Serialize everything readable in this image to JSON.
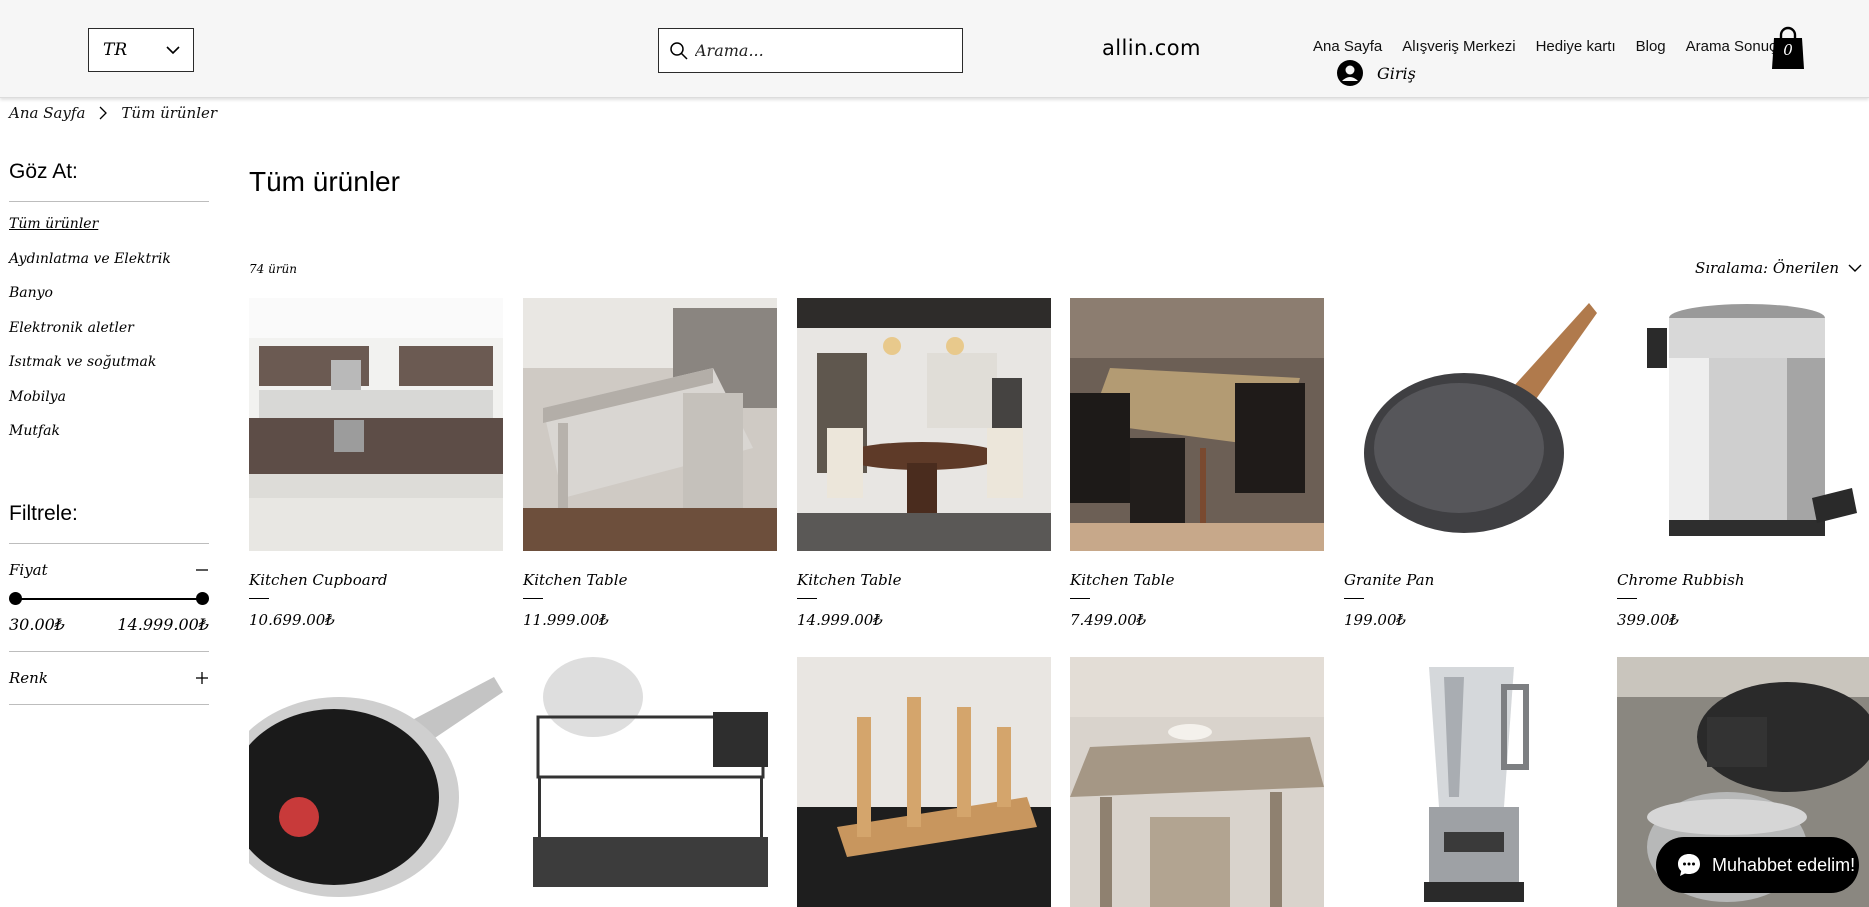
{
  "header": {
    "language": "TR",
    "search_placeholder": "Arama...",
    "logo": "allin.com",
    "nav": [
      "Ana Sayfa",
      "Alışveriş Merkezi",
      "Hediye kartı",
      "Blog",
      "Arama Sonuçları"
    ],
    "login_label": "Giriş",
    "cart_count": "0"
  },
  "breadcrumb": {
    "home": "Ana Sayfa",
    "current": "Tüm ürünler"
  },
  "sidebar": {
    "browse_title": "Göz At:",
    "categories": [
      "Tüm ürünler",
      "Aydınlatma ve Elektrik",
      "Banyo",
      "Elektronik aletler",
      "Isıtmak ve soğutmak",
      "Mobilya",
      "Mutfak"
    ],
    "filter_title": "Filtrele:",
    "price_label": "Fiyat",
    "price_min": "30.00₺",
    "price_max": "14.999.00₺",
    "color_label": "Renk"
  },
  "main": {
    "title": "Tüm ürünler",
    "count": "74 ürün",
    "sort_label": "Sıralama: Önerilen"
  },
  "products": [
    {
      "name": "Kitchen Cupboard",
      "price": "10.699.00₺"
    },
    {
      "name": "Kitchen Table",
      "price": "11.999.00₺"
    },
    {
      "name": "Kitchen Table",
      "price": "14.999.00₺"
    },
    {
      "name": "Kitchen Table",
      "price": "7.499.00₺"
    },
    {
      "name": "Granite Pan",
      "price": "199.00₺"
    },
    {
      "name": "Chrome Rubbish",
      "price": "399.00₺"
    }
  ],
  "chat": {
    "label": "Muhabbet edelim!"
  }
}
